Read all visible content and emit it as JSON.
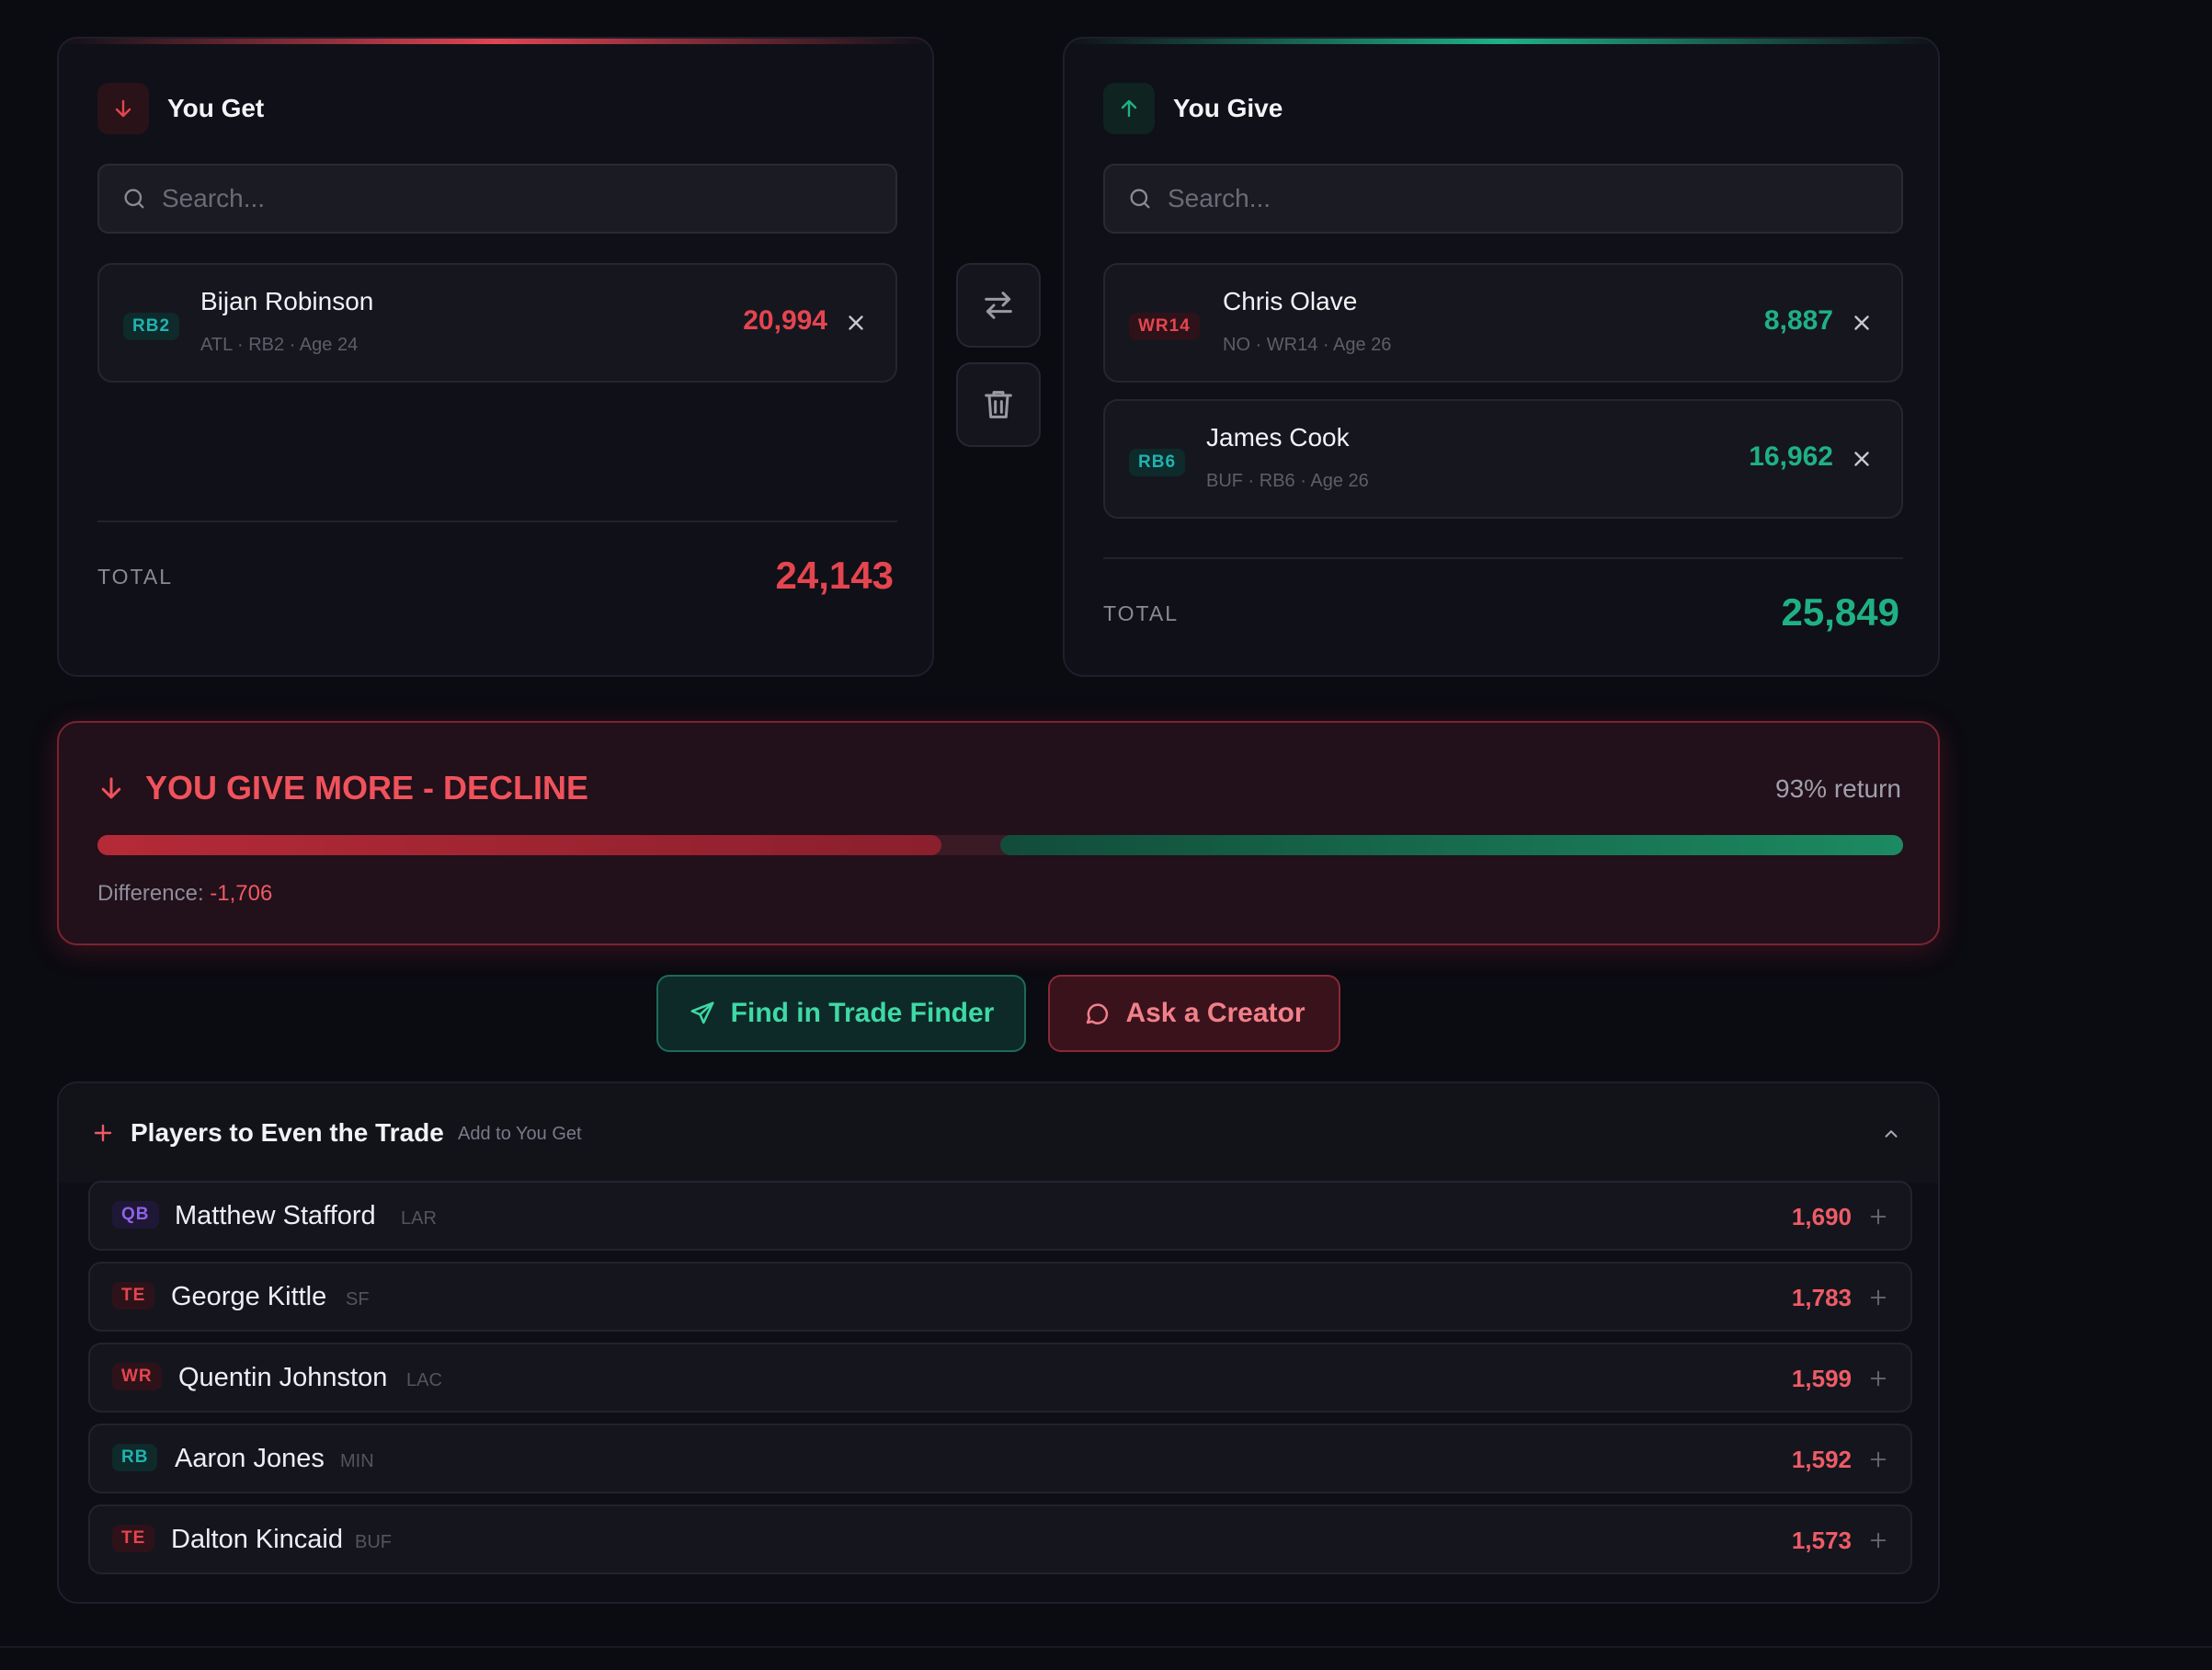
{
  "you_get": {
    "title": "You Get",
    "search_placeholder": "Search...",
    "players": [
      {
        "pos": "RB2",
        "name": "Bijan Robinson",
        "meta": "ATL · RB2 · Age 24",
        "value": "20,994"
      }
    ],
    "total_label": "TOTAL",
    "total_value": "24,143"
  },
  "you_give": {
    "title": "You Give",
    "search_placeholder": "Search...",
    "players": [
      {
        "pos": "WR14",
        "name": "Chris Olave",
        "meta": "NO · WR14 · Age 26",
        "value": "8,887"
      },
      {
        "pos": "RB6",
        "name": "James Cook",
        "meta": "BUF · RB6 · Age 26",
        "value": "16,962"
      }
    ],
    "total_label": "TOTAL",
    "total_value": "25,849"
  },
  "verdict": {
    "title": "YOU GIVE MORE - DECLINE",
    "return_text": "93% return",
    "difference_label": "Difference:",
    "difference_value": "-1,706",
    "bar": {
      "get_fraction": 0.483,
      "give_fraction": 0.517
    }
  },
  "actions": {
    "finder_label": "Find in Trade Finder",
    "creator_label": "Ask a Creator"
  },
  "even": {
    "title": "Players to Even the Trade",
    "subtitle": "Add to You Get",
    "players": [
      {
        "pos": "QB",
        "name": "Matthew Stafford",
        "team": "LAR",
        "value": "1,690",
        "color": "purple"
      },
      {
        "pos": "TE",
        "name": "George Kittle",
        "team": "SF",
        "value": "1,783",
        "color": "red"
      },
      {
        "pos": "WR",
        "name": "Quentin Johnston",
        "team": "LAC",
        "value": "1,599",
        "color": "red"
      },
      {
        "pos": "RB",
        "name": "Aaron Jones",
        "team": "MIN",
        "value": "1,592",
        "color": "teal"
      },
      {
        "pos": "TE",
        "name": "Dalton Kincaid",
        "team": "BUF",
        "value": "1,573",
        "color": "red"
      }
    ]
  },
  "colors": {
    "get_accent": "#e5454f",
    "give_accent": "#1fb184",
    "background": "#0b0b12"
  }
}
